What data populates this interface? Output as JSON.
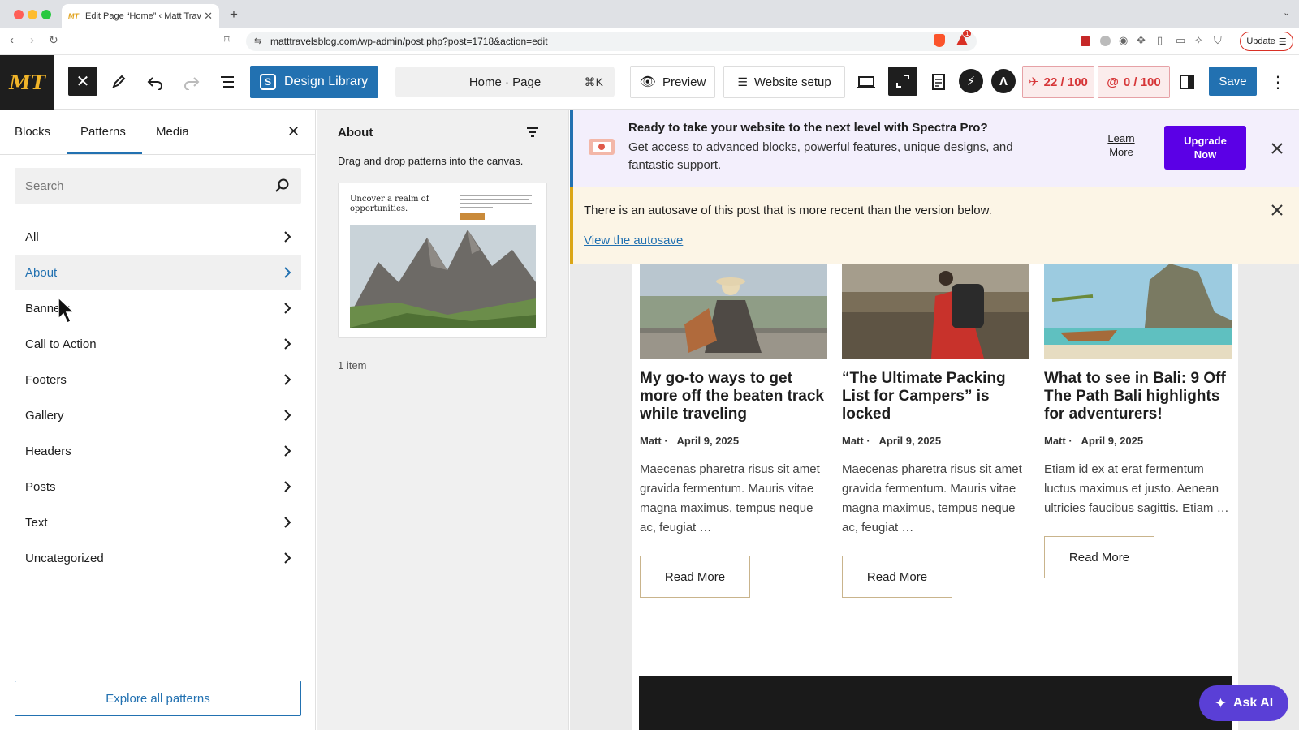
{
  "browser": {
    "tab_title": "Edit Page “Home” ‹ Matt Trav",
    "tab_favicon": "MT",
    "url": "matttravelsblog.com/wp-admin/post.php?post=1718&action=edit",
    "update_label": "Update",
    "shield_badge": "1"
  },
  "toolbar": {
    "logo": "MT",
    "design_library_label": "Design Library",
    "doc_title": "Home · Page",
    "shortcut": "⌘K",
    "preview_label": "Preview",
    "website_setup_label": "Website setup",
    "seo_score": "22 / 100",
    "readability_score": "0 / 100",
    "save_label": "Save"
  },
  "inserter": {
    "tabs": [
      "Blocks",
      "Patterns",
      "Media"
    ],
    "search_placeholder": "Search",
    "categories": [
      "All",
      "About",
      "Banners",
      "Call to Action",
      "Footers",
      "Gallery",
      "Headers",
      "Posts",
      "Text",
      "Uncategorized"
    ],
    "active_category": "About",
    "explore_label": "Explore all patterns"
  },
  "patterns_panel": {
    "title": "About",
    "hint": "Drag and drop patterns into the canvas.",
    "preview_heading": "Uncover a realm of opportunities.",
    "count": "1 item"
  },
  "notices": {
    "spectra_title": "Ready to take your website to the next level with Spectra Pro?",
    "spectra_body": "Get access to advanced blocks, powerful features, unique designs, and fantastic support.",
    "learn_more": "Learn More",
    "upgrade_now": "Upgrade Now",
    "autosave_text": "There is an autosave of this post that is more recent than the version below.",
    "autosave_link": "View the autosave"
  },
  "posts": [
    {
      "title": "My go-to ways to get more off the beaten track while traveling",
      "author": "Matt ·",
      "date": "April 9, 2025",
      "excerpt": "Maecenas pharetra risus sit amet gravida fermentum. Mauris vitae magna maximus, tempus neque ac, feugiat …",
      "read_more": "Read More"
    },
    {
      "title": "“The Ultimate Packing List for Campers” is locked",
      "author": "Matt ·",
      "date": "April 9, 2025",
      "excerpt": "Maecenas pharetra risus sit amet gravida fermentum. Mauris vitae magna maximus, tempus neque ac, feugiat …",
      "read_more": "Read More"
    },
    {
      "title": "What to see in Bali: 9 Off The Path Bali highlights for adventurers!",
      "author": "Matt ·",
      "date": "April 9, 2025",
      "excerpt": "Etiam id ex at erat fermentum luctus maximus et justo. Aenean ultricies faucibus sagittis. Etiam …",
      "read_more": "Read More"
    }
  ],
  "ask_ai_label": "Ask AI",
  "colors": {
    "wp_blue": "#2271b1",
    "spectra_purple": "#5b00e6",
    "notice_warning": "#dba617"
  }
}
